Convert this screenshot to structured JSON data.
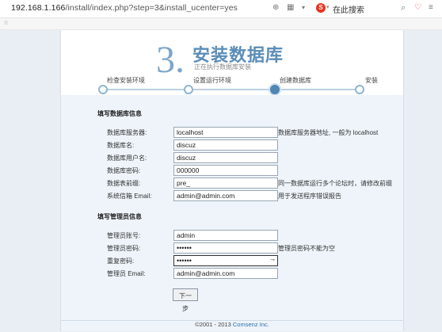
{
  "browser": {
    "url_host": "192.168.1.166",
    "url_path": "/install/index.php?step=3&install_ucenter=yes",
    "search_label": "在此搜索",
    "icons": [
      "document-icon",
      "reader-icon",
      "dropdown-icon",
      "search-engine-icon",
      "search-icon",
      "heart-icon",
      "menu-icon"
    ]
  },
  "header": {
    "step_number": "3.",
    "title": "安装数据库",
    "subtitle": "正在执行数据库安装"
  },
  "progress": {
    "steps": [
      {
        "label": "检查安装环境",
        "active": false
      },
      {
        "label": "设置运行环境",
        "active": false
      },
      {
        "label": "创建数据库",
        "active": true
      },
      {
        "label": "安装",
        "active": false
      }
    ]
  },
  "db_section": {
    "title": "填写数据库信息",
    "fields": [
      {
        "label": "数据库服务器:",
        "value": "localhost",
        "hint": "数据库服务器地址, 一般为 localhost"
      },
      {
        "label": "数据库名:",
        "value": "discuz",
        "hint": ""
      },
      {
        "label": "数据库用户名:",
        "value": "discuz",
        "hint": ""
      },
      {
        "label": "数据库密码:",
        "value": "000000",
        "hint": ""
      },
      {
        "label": "数据表前缀:",
        "value": "pre_",
        "hint": "同一数据库运行多个论坛时，请修改前缀"
      },
      {
        "label": "系统信箱 Email:",
        "value": "admin@admin.com",
        "hint": "用于发送程序错误报告"
      }
    ]
  },
  "admin_section": {
    "title": "填写管理员信息",
    "fields": [
      {
        "label": "管理员账号:",
        "value": "admin",
        "hint": ""
      },
      {
        "label": "管理员密码:",
        "value": "••••••",
        "hint": "管理员密码不能为空"
      },
      {
        "label": "重复密码:",
        "value": "••••••",
        "hint": ""
      },
      {
        "label": "管理员 Email:",
        "value": "admin@admin.com",
        "hint": ""
      }
    ]
  },
  "actions": {
    "next_label": "下一步"
  },
  "footer": {
    "copyright": "©2001 - 2013",
    "company": "Comsenz Inc."
  },
  "colors": {
    "accent": "#5b8db8",
    "progress_active": "#4e86b6",
    "content_bg": "#eef4fa"
  }
}
